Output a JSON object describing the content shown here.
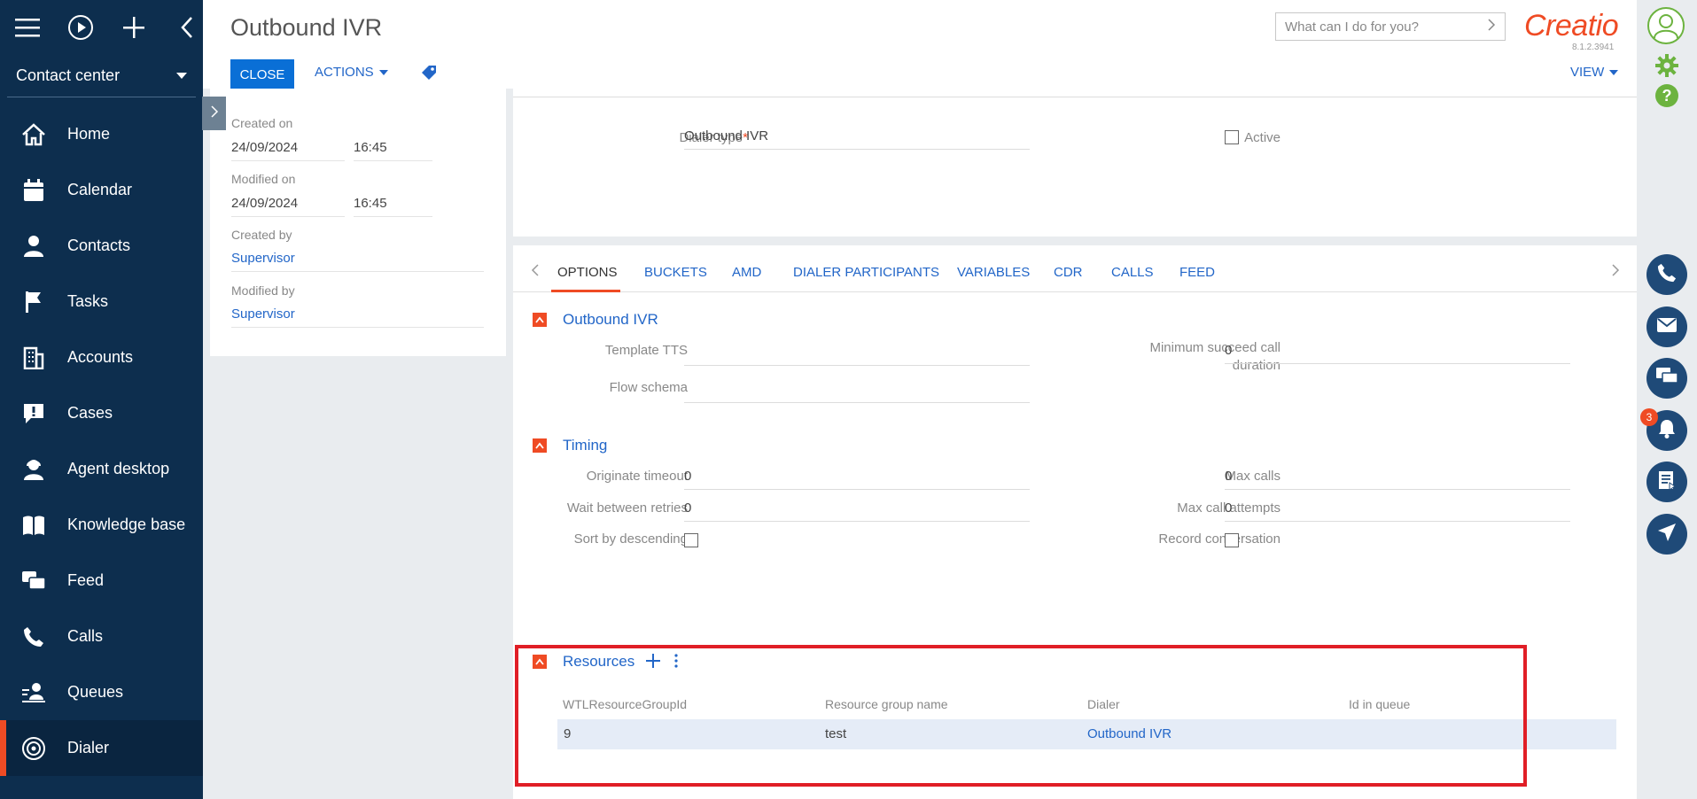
{
  "sidebar": {
    "workspace": "Contact center",
    "items": [
      {
        "label": "Home",
        "icon": "home-icon"
      },
      {
        "label": "Calendar",
        "icon": "calendar-icon"
      },
      {
        "label": "Contacts",
        "icon": "contacts-icon"
      },
      {
        "label": "Tasks",
        "icon": "flag-icon"
      },
      {
        "label": "Accounts",
        "icon": "building-icon"
      },
      {
        "label": "Cases",
        "icon": "cases-icon"
      },
      {
        "label": "Agent desktop",
        "icon": "agent-icon"
      },
      {
        "label": "Knowledge base",
        "icon": "book-icon"
      },
      {
        "label": "Feed",
        "icon": "feed-icon"
      },
      {
        "label": "Calls",
        "icon": "phone-icon"
      },
      {
        "label": "Queues",
        "icon": "queues-icon"
      },
      {
        "label": "Dialer",
        "icon": "dialer-icon"
      }
    ],
    "active_item": "Dialer"
  },
  "header": {
    "title": "Outbound IVR",
    "close_label": "CLOSE",
    "actions_label": "ACTIONS",
    "search_placeholder": "What can I do for you?",
    "logo": "Creatio",
    "version": "8.1.2.3941",
    "view_label": "VIEW"
  },
  "info": {
    "created_on_label": "Created on",
    "created_on_date": "24/09/2024",
    "created_on_time": "16:45",
    "modified_on_label": "Modified on",
    "modified_on_date": "24/09/2024",
    "modified_on_time": "16:45",
    "created_by_label": "Created by",
    "created_by": "Supervisor",
    "modified_by_label": "Modified by",
    "modified_by": "Supervisor"
  },
  "top_form": {
    "dialer_type_label": "Dialer type",
    "dialer_type": "Outbound IVR",
    "active_label": "Active",
    "active_checked": false
  },
  "tabs": [
    "OPTIONS",
    "BUCKETS",
    "AMD",
    "DIALER PARTICIPANTS",
    "VARIABLES",
    "CDR",
    "CALLS",
    "FEED"
  ],
  "active_tab": "OPTIONS",
  "sections": {
    "outbound_ivr": {
      "title": "Outbound IVR",
      "template_tts_label": "Template TTS",
      "template_tts": "",
      "flow_schema_label": "Flow schema",
      "flow_schema": "",
      "min_succeed_label_1": "Minimum succeed call",
      "min_succeed_label_2": "duration",
      "min_succeed": "0"
    },
    "timing": {
      "title": "Timing",
      "originate_timeout_label": "Originate timeout",
      "originate_timeout": "0",
      "wait_between_retries_label": "Wait between retries",
      "wait_between_retries": "0",
      "sort_desc_label": "Sort by descending",
      "max_calls_label": "Max calls",
      "max_calls": "0",
      "max_call_attempts_label": "Max call attempts",
      "max_call_attempts": "0",
      "record_conversation_label": "Record conversation"
    },
    "resources": {
      "title": "Resources",
      "columns": [
        "WTLResourceGroupId",
        "Resource group name",
        "Dialer",
        "Id in queue"
      ],
      "rows": [
        {
          "id": "9",
          "name": "test",
          "dialer": "Outbound IVR",
          "queue_id": ""
        }
      ]
    }
  },
  "notifications": {
    "count": "3"
  },
  "colors": {
    "sidebar": "#0d2e4e",
    "accent": "#ef4b24",
    "link": "#2266c8",
    "primary_button": "#0a6fd6",
    "highlight_frame": "#e01e26"
  }
}
